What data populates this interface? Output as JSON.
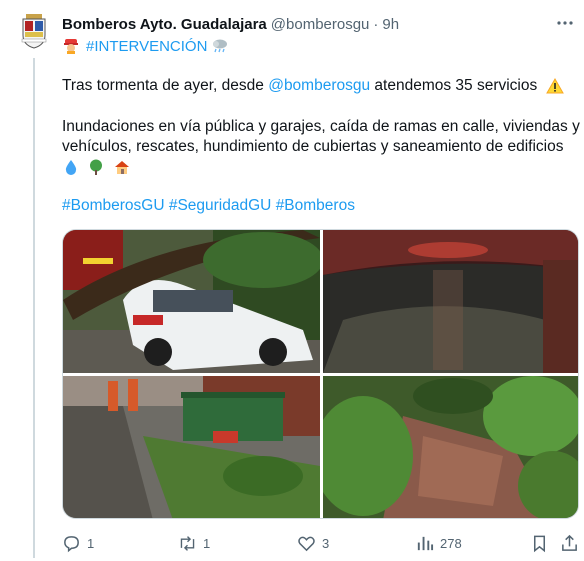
{
  "tweet": {
    "author_name": "Bomberos Ayto. Guadalajara",
    "handle": "@bomberosgu",
    "separator": "·",
    "time": "9h",
    "tag_line": "#INTERVENCIÓN",
    "text_part1": "Tras tormenta de ayer, desde ",
    "mention": "@bomberosgu",
    "text_part2": " atendemos 35 servicios",
    "text_line2a": "Inundaciones en vía pública y garajes, caída de ramas en calle, viviendas y",
    "text_line2b": "vehículos, rescates, hundimiento de cubiertas y saneamiento de edificios",
    "hashtags": [
      "#BomberosGU",
      "#SeguridadGU",
      "#Bomberos"
    ]
  },
  "icons": {
    "avatar": "fire-department-shield-icon",
    "firefighter": "firefighter-emoji-icon",
    "storm": "storm-cloud-emoji-icon",
    "warning": "warning-emoji-icon",
    "droplet": "droplet-emoji-icon",
    "tree": "tree-emoji-icon",
    "house": "house-emoji-icon",
    "more": "more-options-icon",
    "reply": "reply-icon",
    "retweet": "retweet-icon",
    "like": "heart-icon",
    "views": "views-chart-icon",
    "bookmark": "bookmark-icon",
    "share": "share-icon"
  },
  "media": [
    {
      "caption": "fallen tree on white car"
    },
    {
      "caption": "flooded tunnel"
    },
    {
      "caption": "firefighters with dumpsters in street"
    },
    {
      "caption": "collapsed wall with plants"
    }
  ],
  "stats": {
    "replies": "1",
    "retweets": "1",
    "likes": "3",
    "views": "278"
  },
  "colors": {
    "accent": "#1d9bf0",
    "text": "#0f1419",
    "muted": "#536471",
    "border": "#cfd9de"
  }
}
